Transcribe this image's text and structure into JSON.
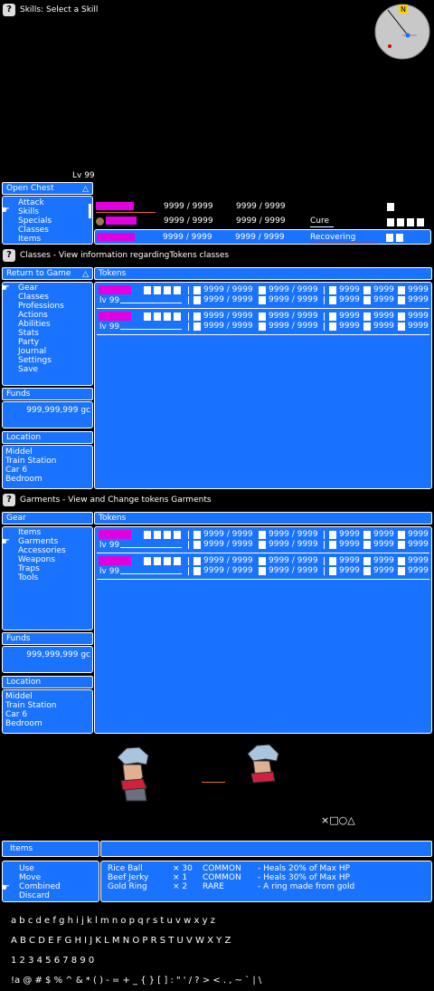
{
  "colors": {
    "window": "#1a73ff",
    "hp_bar": "#e000e0",
    "text": "#ffffff",
    "background": "#000000"
  },
  "skills_screen": {
    "help_icon": "?",
    "title": "Skills: Select a Skill",
    "level": "Lv 99",
    "menu_header": "Open Chest",
    "menu_items": [
      "Attack",
      "Skills",
      "Specials",
      "Classes",
      "Items"
    ],
    "party": [
      {
        "hp": "9999 / 9999",
        "mp": "9999 / 9999",
        "status": "",
        "slots": 1
      },
      {
        "hp": "9999 / 9999",
        "mp": "9999 / 9999",
        "status": "Cure",
        "slots": 4
      },
      {
        "hp": "9999 / 9999",
        "mp": "9999 / 9999",
        "status": "Recovering",
        "slots": 2
      }
    ]
  },
  "classes_screen": {
    "help_icon": "?",
    "title": "Classes - View information regardingTokens classes",
    "menu_header": "Return to Game",
    "column_header": "Tokens",
    "menu_items": [
      "Gear",
      "Classes",
      "Professions",
      "Actions",
      "Abilities",
      "Stats",
      "Party",
      "Journal",
      "Settings",
      "Save"
    ],
    "funds_label": "Funds",
    "funds_value": "999,999,999 gc",
    "location_label": "Location",
    "location_lines": [
      "Middel",
      "Train Station",
      "Car 6",
      "Bedroom"
    ],
    "members": [
      {
        "level": "lv 99",
        "stat": "9999 / 9999",
        "short": "9999"
      },
      {
        "level": "lv 99",
        "stat": "9999 / 9999",
        "short": "9999"
      }
    ]
  },
  "garments_screen": {
    "help_icon": "?",
    "title": "Garments - View and Change tokens Garments",
    "menu_header": "Gear",
    "column_header": "Tokens",
    "menu_items": [
      "Items",
      "Garments",
      "Accessories",
      "Weapons",
      "Traps",
      "Tools"
    ],
    "funds_label": "Funds",
    "funds_value": "999,999,999 gc",
    "location_label": "Location",
    "location_lines": [
      "Middel",
      "Train Station",
      "Car 6",
      "Bedroom"
    ],
    "members": [
      {
        "level": "lv 99",
        "stat": "9999 / 9999",
        "short": "9999"
      },
      {
        "level": "lv 99",
        "stat": "9999 / 9999",
        "short": "9999"
      }
    ]
  },
  "battle_prompt": "×□○△",
  "items_screen": {
    "header": "Items",
    "actions": [
      "Use",
      "Move",
      "Combined",
      "Discard"
    ],
    "items": [
      {
        "name": "Rice Ball",
        "qty": "× 30",
        "rarity": "COMMON",
        "desc": "- Heals 20% of Max HP"
      },
      {
        "name": "Beef Jerky",
        "qty": "× 1",
        "rarity": "COMMON",
        "desc": "- Heals 30% of Max HP"
      },
      {
        "name": "Gold Ring",
        "qty": "× 2",
        "rarity": "RARE",
        "desc": "- A ring made from gold"
      }
    ]
  },
  "font_sample": {
    "lowercase": "a b c d e f g h i j k l m n o p q r s t u v w x y z",
    "uppercase": "A B C D E F G H I J K L M N O P R S T U V W X Y Z",
    "digits": "1 2 3 4 5 6 7 8 9 0",
    "symbols": "!a @ # $ % ^ & * ( ) - = + _ { } [ ] : \" ' / ? > < . , ~ ` | \\"
  }
}
